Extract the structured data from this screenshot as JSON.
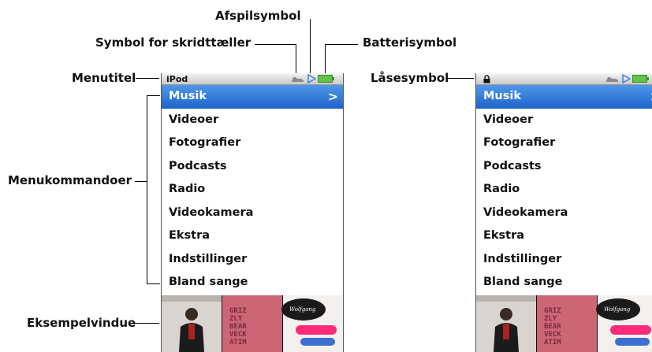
{
  "callouts": {
    "play_symbol": "Afspilsymbol",
    "pedometer_symbol": "Symbol for skridttæller",
    "battery_symbol": "Batterisymbol",
    "menu_title": "Menutitel",
    "lock_symbol": "Låsesymbol",
    "menu_commands": "Menukommandoer",
    "preview_window": "Eksempelvindue"
  },
  "screen_left": {
    "title": "iPod",
    "menu": [
      "Musik",
      "Videoer",
      "Fotografier",
      "Podcasts",
      "Radio",
      "Videokamera",
      "Ekstra",
      "Indstillinger",
      "Bland sange"
    ],
    "selected_chevron": ">"
  },
  "screen_right": {
    "menu": [
      "Musik",
      "Videoer",
      "Fotografier",
      "Podcasts",
      "Radio",
      "Videokamera",
      "Ekstra",
      "Indstillinger",
      "Bland sange"
    ],
    "selected_chevron": ">"
  },
  "album_art": {
    "album_2_text": "GRIZZLY BEAR VECKATIMEST",
    "album_3_text": "Wolfgang Amadeus Phoenix"
  },
  "colors": {
    "selection": "#2d72d6",
    "play_icon": "#3b7fe0",
    "battery": "#5fc24a"
  }
}
